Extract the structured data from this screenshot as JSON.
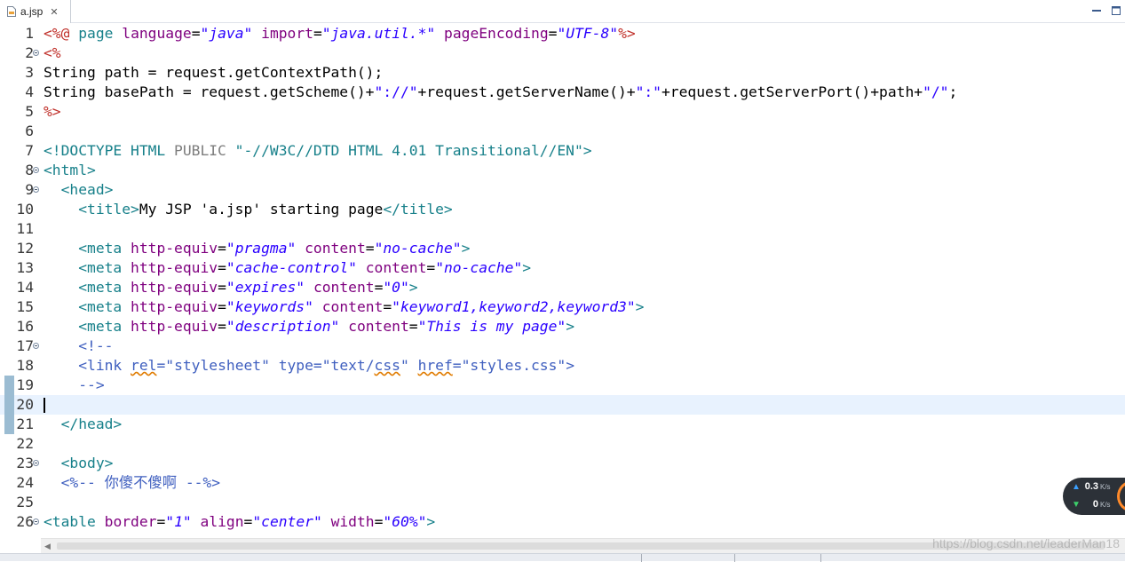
{
  "tab": {
    "label": "a.jsp",
    "close_glyph": "✕"
  },
  "editor": {
    "current_line": 20,
    "lines": [
      {
        "n": "1",
        "fold": false,
        "tokens": [
          [
            "d",
            "<%@"
          ],
          [
            "p",
            " "
          ],
          [
            "tag",
            "page"
          ],
          [
            "p",
            " "
          ],
          [
            "attr",
            "language"
          ],
          [
            "p",
            "="
          ],
          [
            "val",
            "\"java\""
          ],
          [
            "p",
            " "
          ],
          [
            "attr",
            "import"
          ],
          [
            "p",
            "="
          ],
          [
            "val",
            "\"java.util.*\""
          ],
          [
            "p",
            " "
          ],
          [
            "attr",
            "pageEncoding"
          ],
          [
            "p",
            "="
          ],
          [
            "val",
            "\"UTF-8\""
          ],
          [
            "d",
            "%>"
          ]
        ]
      },
      {
        "n": "2",
        "fold": true,
        "tokens": [
          [
            "d",
            "<%"
          ]
        ]
      },
      {
        "n": "3",
        "fold": false,
        "tokens": [
          [
            "p",
            "String path = request.getContextPath();"
          ]
        ]
      },
      {
        "n": "4",
        "fold": false,
        "tokens": [
          [
            "p",
            "String basePath = request.getScheme()+"
          ],
          [
            "jstr",
            "\"://\""
          ],
          [
            "p",
            "+request.getServerName()+"
          ],
          [
            "jstr",
            "\":\""
          ],
          [
            "p",
            "+request.getServerPort()+path+"
          ],
          [
            "jstr",
            "\"/\""
          ],
          [
            "p",
            ";"
          ]
        ]
      },
      {
        "n": "5",
        "fold": false,
        "tokens": [
          [
            "d",
            "%>"
          ]
        ]
      },
      {
        "n": "6",
        "fold": false,
        "tokens": []
      },
      {
        "n": "7",
        "fold": false,
        "tokens": [
          [
            "dt",
            "<!DOCTYPE HTML "
          ],
          [
            "dtg",
            "PUBLIC"
          ],
          [
            "dt",
            " \"-//W3C//DTD HTML 4.01 Transitional//EN\">"
          ]
        ]
      },
      {
        "n": "8",
        "fold": true,
        "tokens": [
          [
            "tag",
            "<html>"
          ]
        ]
      },
      {
        "n": "9",
        "fold": true,
        "tokens": [
          [
            "p",
            "  "
          ],
          [
            "tag",
            "<head>"
          ]
        ]
      },
      {
        "n": "10",
        "fold": false,
        "tokens": [
          [
            "p",
            "    "
          ],
          [
            "tag",
            "<title>"
          ],
          [
            "p",
            "My JSP 'a.jsp' starting page"
          ],
          [
            "tag",
            "</title>"
          ]
        ]
      },
      {
        "n": "11",
        "fold": false,
        "tokens": []
      },
      {
        "n": "12",
        "fold": false,
        "tokens": [
          [
            "p",
            "    "
          ],
          [
            "tag",
            "<meta"
          ],
          [
            "p",
            " "
          ],
          [
            "attr",
            "http-equiv"
          ],
          [
            "p",
            "="
          ],
          [
            "val",
            "\"pragma\""
          ],
          [
            "p",
            " "
          ],
          [
            "attr",
            "content"
          ],
          [
            "p",
            "="
          ],
          [
            "val",
            "\"no-cache\""
          ],
          [
            "tag",
            ">"
          ]
        ]
      },
      {
        "n": "13",
        "fold": false,
        "tokens": [
          [
            "p",
            "    "
          ],
          [
            "tag",
            "<meta"
          ],
          [
            "p",
            " "
          ],
          [
            "attr",
            "http-equiv"
          ],
          [
            "p",
            "="
          ],
          [
            "val",
            "\"cache-control\""
          ],
          [
            "p",
            " "
          ],
          [
            "attr",
            "content"
          ],
          [
            "p",
            "="
          ],
          [
            "val",
            "\"no-cache\""
          ],
          [
            "tag",
            ">"
          ]
        ]
      },
      {
        "n": "14",
        "fold": false,
        "tokens": [
          [
            "p",
            "    "
          ],
          [
            "tag",
            "<meta"
          ],
          [
            "p",
            " "
          ],
          [
            "attr",
            "http-equiv"
          ],
          [
            "p",
            "="
          ],
          [
            "val",
            "\"expires\""
          ],
          [
            "p",
            " "
          ],
          [
            "attr",
            "content"
          ],
          [
            "p",
            "="
          ],
          [
            "val",
            "\"0\""
          ],
          [
            "tag",
            ">"
          ]
        ]
      },
      {
        "n": "15",
        "fold": false,
        "tokens": [
          [
            "p",
            "    "
          ],
          [
            "tag",
            "<meta"
          ],
          [
            "p",
            " "
          ],
          [
            "attr",
            "http-equiv"
          ],
          [
            "p",
            "="
          ],
          [
            "val",
            "\"keywords\""
          ],
          [
            "p",
            " "
          ],
          [
            "attr",
            "content"
          ],
          [
            "p",
            "="
          ],
          [
            "val",
            "\"keyword1,keyword2,keyword3\""
          ],
          [
            "tag",
            ">"
          ]
        ]
      },
      {
        "n": "16",
        "fold": false,
        "tokens": [
          [
            "p",
            "    "
          ],
          [
            "tag",
            "<meta"
          ],
          [
            "p",
            " "
          ],
          [
            "attr",
            "http-equiv"
          ],
          [
            "p",
            "="
          ],
          [
            "val",
            "\"description\""
          ],
          [
            "p",
            " "
          ],
          [
            "attr",
            "content"
          ],
          [
            "p",
            "="
          ],
          [
            "val",
            "\"This is my page\""
          ],
          [
            "tag",
            ">"
          ]
        ]
      },
      {
        "n": "17",
        "fold": true,
        "tokens": [
          [
            "p",
            "    "
          ],
          [
            "cmt",
            "<!--"
          ]
        ]
      },
      {
        "n": "18",
        "fold": false,
        "tokens": [
          [
            "p",
            "    "
          ],
          [
            "cmt",
            "<link "
          ],
          [
            "cmtu",
            "rel"
          ],
          [
            "cmt",
            "=\"stylesheet\" type=\"text/"
          ],
          [
            "cmtu",
            "css"
          ],
          [
            "cmt",
            "\" "
          ],
          [
            "cmtu",
            "href"
          ],
          [
            "cmt",
            "=\"styles.css\">"
          ]
        ]
      },
      {
        "n": "19",
        "fold": false,
        "tokens": [
          [
            "p",
            "    "
          ],
          [
            "cmt",
            "-->"
          ]
        ]
      },
      {
        "n": "20",
        "fold": false,
        "tokens": []
      },
      {
        "n": "21",
        "fold": false,
        "tokens": [
          [
            "p",
            "  "
          ],
          [
            "tag",
            "</head>"
          ]
        ]
      },
      {
        "n": "22",
        "fold": false,
        "tokens": []
      },
      {
        "n": "23",
        "fold": true,
        "tokens": [
          [
            "p",
            "  "
          ],
          [
            "tag",
            "<body>"
          ]
        ]
      },
      {
        "n": "24",
        "fold": false,
        "tokens": [
          [
            "p",
            "  "
          ],
          [
            "jcm",
            "<%-- 你傻不傻啊 --%>"
          ]
        ]
      },
      {
        "n": "25",
        "fold": false,
        "tokens": []
      },
      {
        "n": "26",
        "fold": true,
        "tokens": [
          [
            "tag",
            "<table"
          ],
          [
            "p",
            " "
          ],
          [
            "attr",
            "border"
          ],
          [
            "p",
            "="
          ],
          [
            "val",
            "\"1\""
          ],
          [
            "p",
            " "
          ],
          [
            "attr",
            "align"
          ],
          [
            "p",
            "="
          ],
          [
            "val",
            "\"center\""
          ],
          [
            "p",
            " "
          ],
          [
            "attr",
            "width"
          ],
          [
            "p",
            "="
          ],
          [
            "val",
            "\"60%\""
          ],
          [
            "tag",
            ">"
          ]
        ]
      }
    ],
    "marked_lines": [
      19,
      20,
      21
    ]
  },
  "watermark": "https://blog.csdn.net/leaderMan18",
  "network": {
    "up_value": "0.3",
    "up_unit": "K/s",
    "down_value": "0",
    "down_unit": "K/s",
    "up_color": "#3aa0ff",
    "down_color": "#3ccf6a"
  },
  "icons": {
    "file": "jsp-file-icon",
    "close": "close-icon",
    "minimize": "minimize-icon",
    "maximize": "maximize-icon",
    "scroll_left": "arrow-left-icon"
  }
}
